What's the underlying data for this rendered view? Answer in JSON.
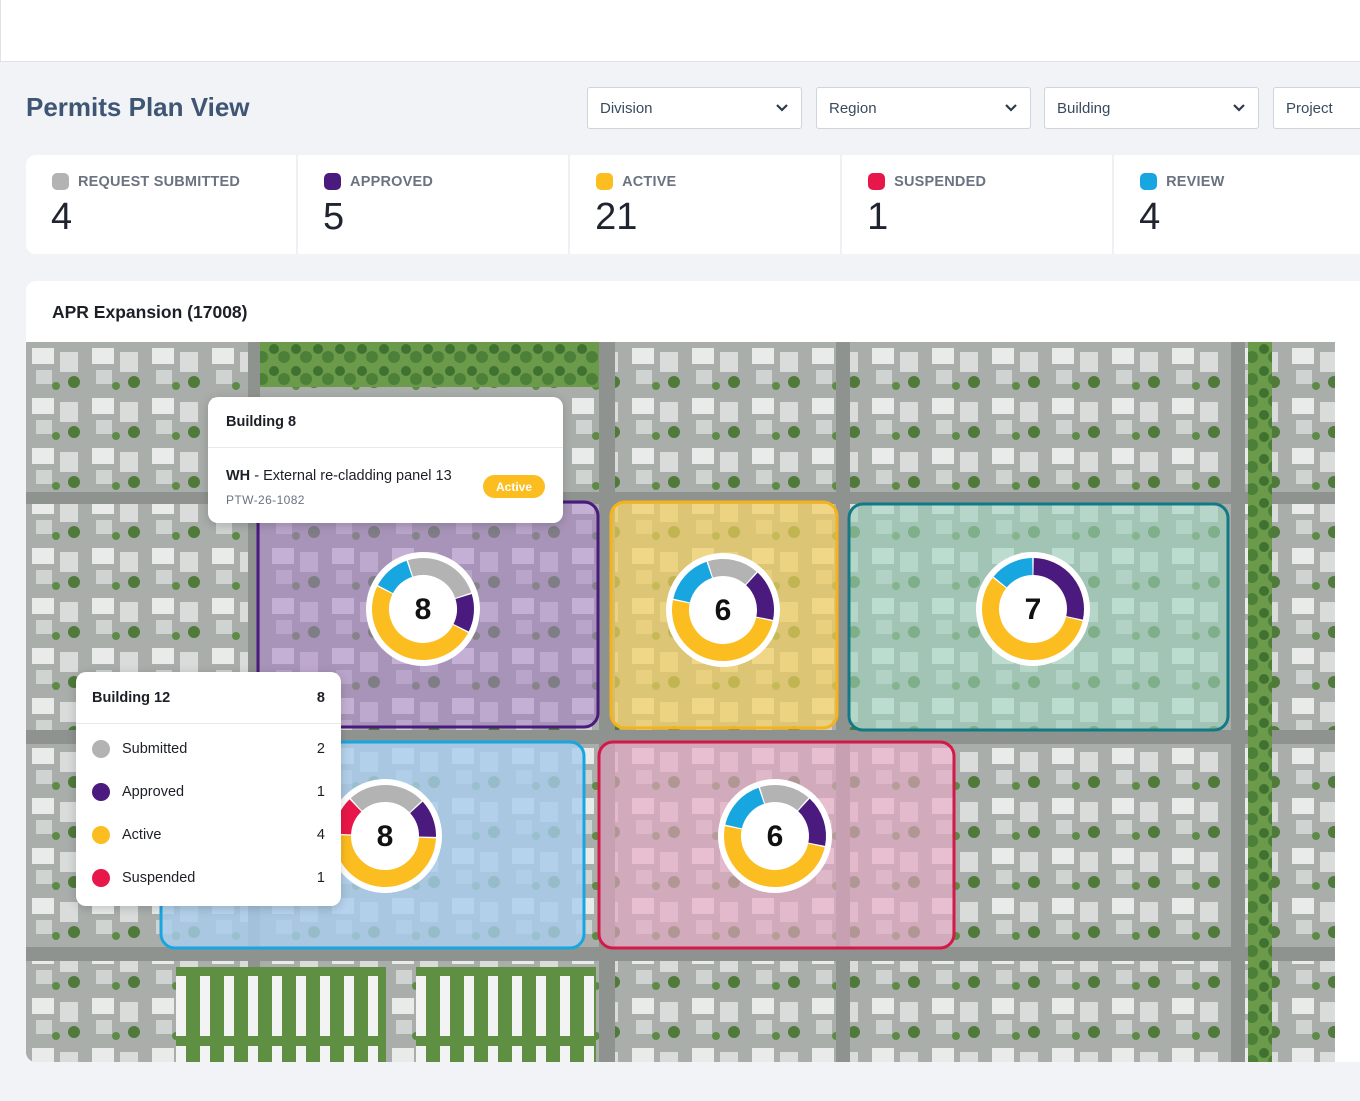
{
  "page": {
    "title": "Permits Plan View"
  },
  "filters": [
    {
      "label": "Division"
    },
    {
      "label": "Region"
    },
    {
      "label": "Building"
    },
    {
      "label": "Project"
    }
  ],
  "stats": [
    {
      "label": "REQUEST SUBMITTED",
      "value": "4",
      "color": "#b3b3b3"
    },
    {
      "label": "APPROVED",
      "value": "5",
      "color": "#4a1a7e"
    },
    {
      "label": "ACTIVE",
      "value": "21",
      "color": "#fbbd1f"
    },
    {
      "label": "SUSPENDED",
      "value": "1",
      "color": "#e8174a"
    },
    {
      "label": "REVIEW",
      "value": "4",
      "color": "#18a6e0"
    }
  ],
  "project": {
    "title": "APR Expansion (17008)"
  },
  "buildings": [
    {
      "total": "8",
      "outline": "#4a1a7e",
      "segments": {
        "submitted": 2,
        "approved": 1,
        "active": 4,
        "review": 1
      }
    },
    {
      "total": "6",
      "outline": "#f5b21a",
      "segments": {
        "submitted": 1,
        "approved": 1,
        "active": 3,
        "review": 1
      }
    },
    {
      "total": "7",
      "outline": "#127a86",
      "segments": {
        "submitted": 0,
        "approved": 2,
        "active": 4,
        "review": 1
      }
    },
    {
      "total": "8",
      "outline": "#18a6e0",
      "segments": {
        "submitted": 2,
        "approved": 1,
        "active": 4,
        "suspended": 1
      }
    },
    {
      "total": "6",
      "outline": "#d6174a",
      "segments": {
        "submitted": 1,
        "approved": 1,
        "active": 3,
        "review": 1
      }
    }
  ],
  "tooltip_building8": {
    "title": "Building 8",
    "code": "WH",
    "separator": " - ",
    "description": "External re-cladding panel 13",
    "permit_id": "PTW-26-1082",
    "status": "Active"
  },
  "tooltip_building12": {
    "title": "Building 12",
    "total": "8",
    "rows": [
      {
        "label": "Submitted",
        "count": "2",
        "color": "#b3b3b3"
      },
      {
        "label": "Approved",
        "count": "1",
        "color": "#4a1a7e"
      },
      {
        "label": "Active",
        "count": "4",
        "color": "#fbbd1f"
      },
      {
        "label": "Suspended",
        "count": "1",
        "color": "#e8174a"
      }
    ]
  },
  "colors": {
    "submitted": "#b3b3b3",
    "approved": "#4a1a7e",
    "active": "#fbbd1f",
    "suspended": "#e8174a",
    "review": "#18a6e0"
  }
}
